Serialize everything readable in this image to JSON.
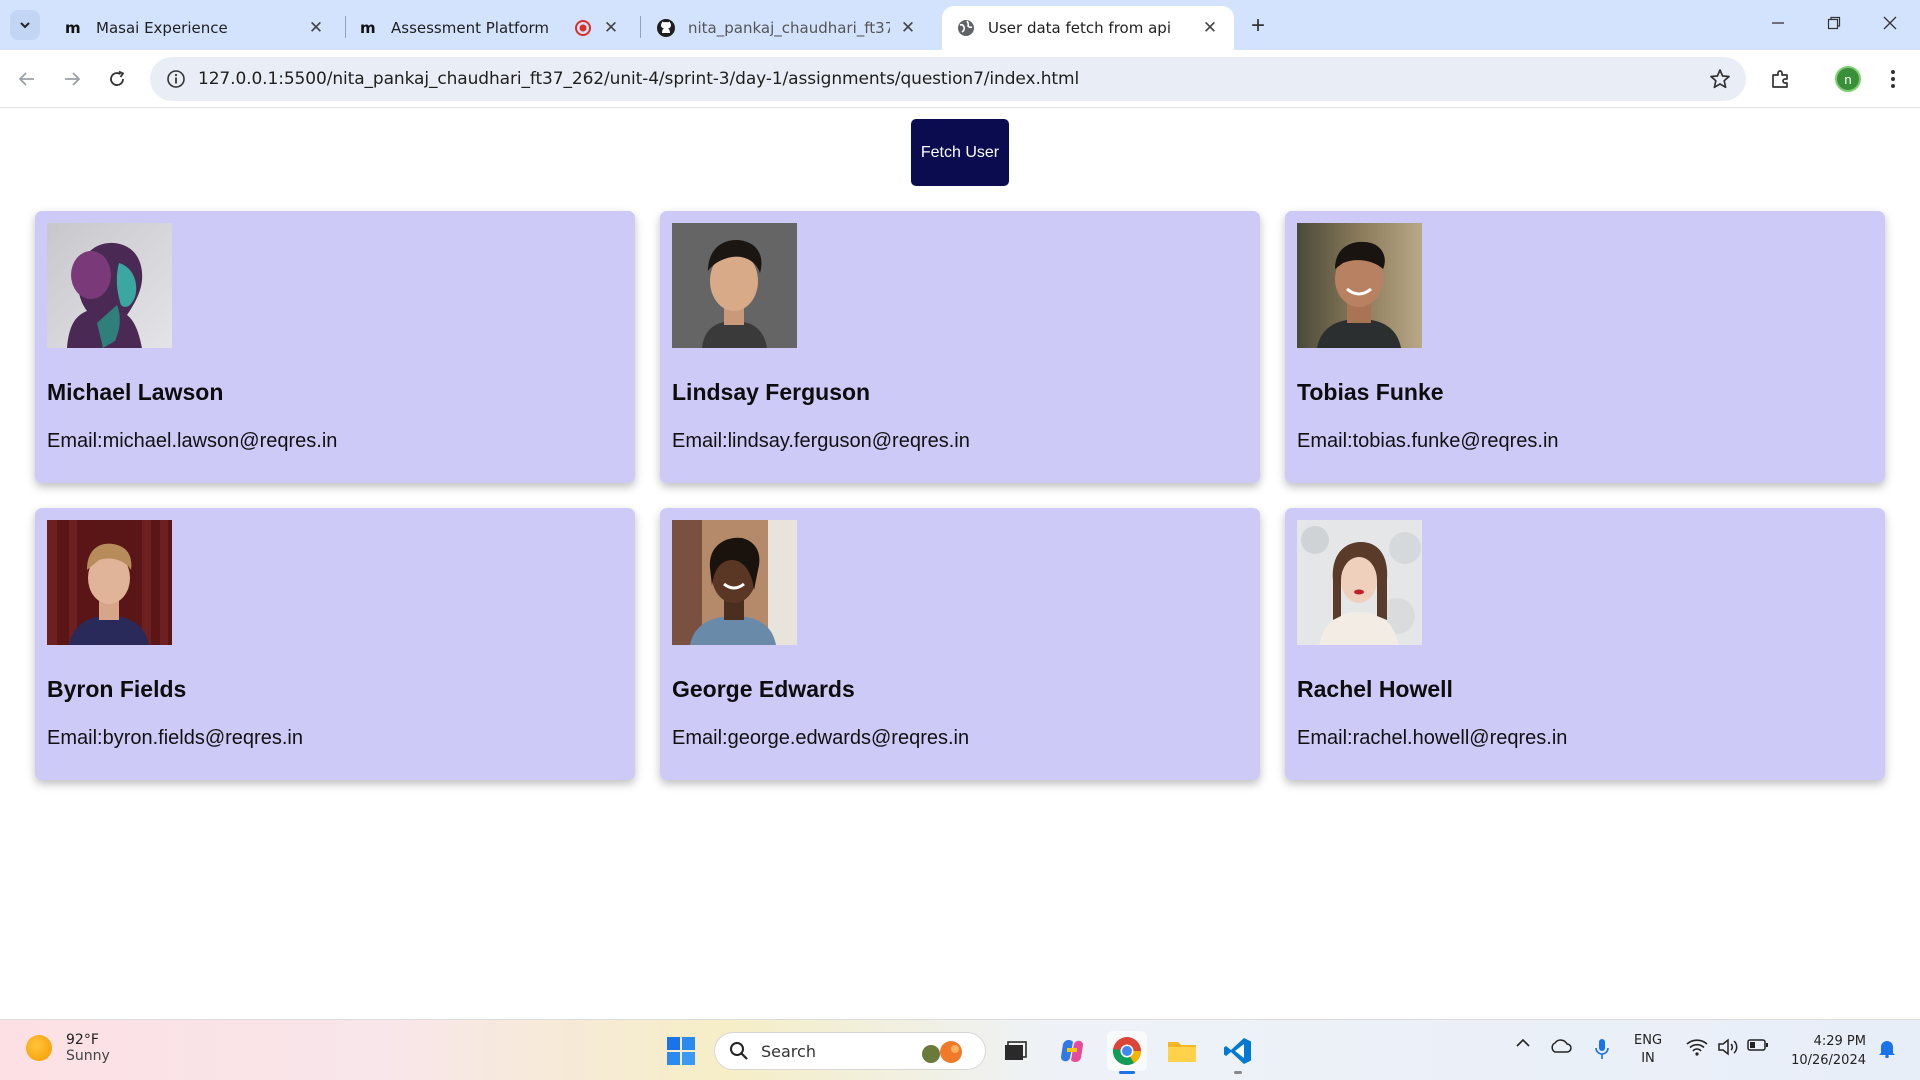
{
  "browser": {
    "tabs": [
      {
        "title": "Masai Experience",
        "favicon": "masai-icon",
        "active": false
      },
      {
        "title": "Assessment Platform",
        "favicon": "masai-icon",
        "active": false
      },
      {
        "title": "nita_pankaj_chaudhari_ft37_262",
        "favicon": "github-icon",
        "active": false
      },
      {
        "title": "User data fetch from api",
        "favicon": "globe-icon",
        "active": true
      }
    ],
    "url": "127.0.0.1:5500/nita_pankaj_chaudhari_ft37_262/unit-4/sprint-3/day-1/assignments/question7/index.html",
    "profile_initial": "n",
    "tab_close_glyph": "✕",
    "new_tab_glyph": "+"
  },
  "page": {
    "fetch_button_label": "Fetch User",
    "users": [
      {
        "name": "Michael Lawson",
        "email": "Email:michael.lawson@reqres.in"
      },
      {
        "name": "Lindsay Ferguson",
        "email": "Email:lindsay.ferguson@reqres.in"
      },
      {
        "name": "Tobias Funke",
        "email": "Email:tobias.funke@reqres.in"
      },
      {
        "name": "Byron Fields",
        "email": "Email:byron.fields@reqres.in"
      },
      {
        "name": "George Edwards",
        "email": "Email:george.edwards@reqres.in"
      },
      {
        "name": "Rachel Howell",
        "email": "Email:rachel.howell@reqres.in"
      }
    ],
    "colors": {
      "card_bg": "#cecaf8",
      "button_bg": "#0b0b4f"
    }
  },
  "taskbar": {
    "weather_temp": "92°F",
    "weather_desc": "Sunny",
    "search_label": "Search",
    "lang_line1": "ENG",
    "lang_line2": "IN",
    "time": "4:29 PM",
    "date": "10/26/2024"
  }
}
